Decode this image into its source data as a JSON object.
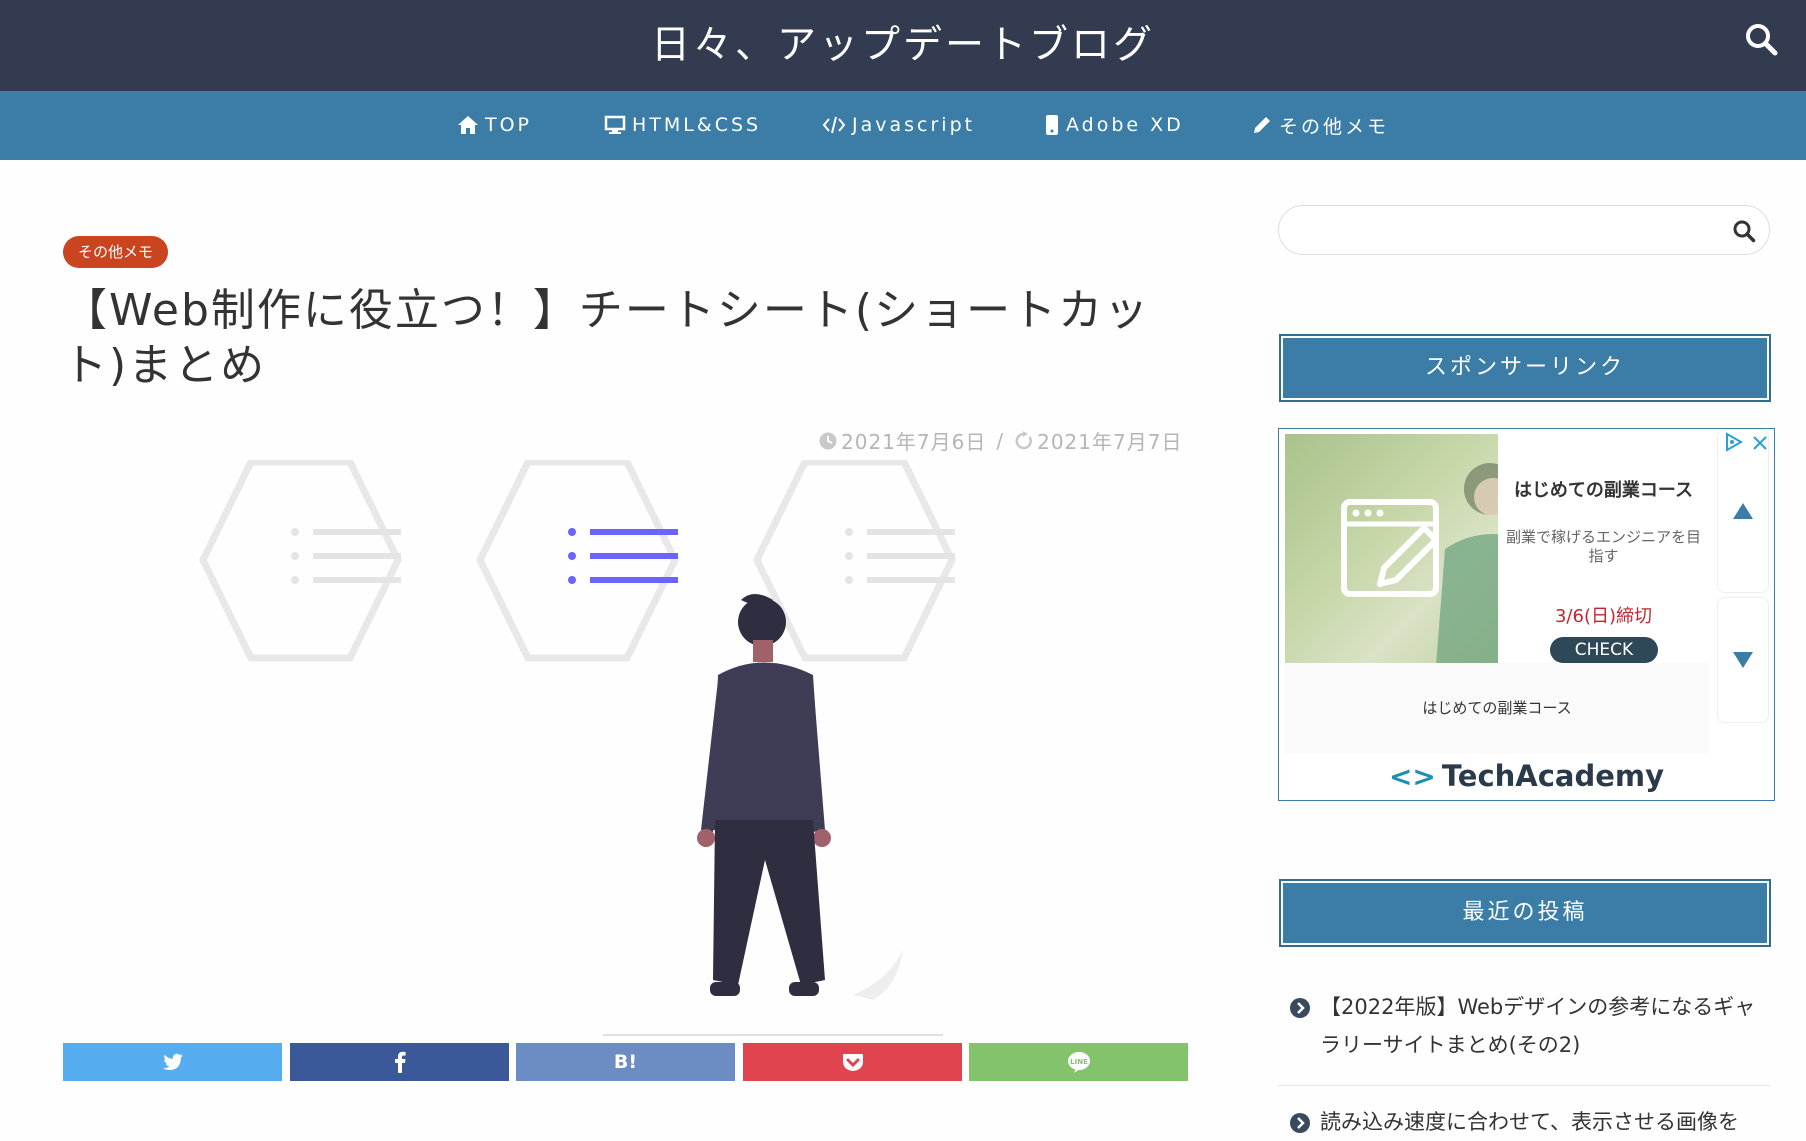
{
  "header": {
    "site_title": "日々、アップデートブログ",
    "search_icon": "search-icon",
    "colors": {
      "header_bg": "#323b4f",
      "nav_bg": "#3b7da6",
      "accent": "#c9441f"
    }
  },
  "nav": {
    "items": [
      {
        "label": "TOP",
        "icon": "home-icon"
      },
      {
        "label": "HTML&CSS",
        "icon": "monitor-icon"
      },
      {
        "label": "Javascript",
        "icon": "code-icon"
      },
      {
        "label": "Adobe XD",
        "icon": "mobile-icon"
      },
      {
        "label": "その他メモ",
        "icon": "pencil-icon"
      }
    ]
  },
  "article": {
    "category": "その他メモ",
    "title": "【Web制作に役立つ！】チートシート(ショートカット)まとめ",
    "published": "2021年7月6日",
    "separator": "/",
    "updated": "2021年7月7日"
  },
  "share": {
    "buttons": [
      {
        "service": "twitter",
        "icon": "twitter-icon",
        "color": "#55acee"
      },
      {
        "service": "facebook",
        "icon": "facebook-icon",
        "color": "#3b5998"
      },
      {
        "service": "hatena",
        "label": "B!",
        "color": "#6b8dc4"
      },
      {
        "service": "pocket",
        "icon": "pocket-icon",
        "color": "#e0444f"
      },
      {
        "service": "line",
        "icon": "line-icon",
        "color": "#83c36b"
      }
    ]
  },
  "sidebar": {
    "search_placeholder": "",
    "sponsor_title": "スポンサーリンク",
    "ad": {
      "headline": "はじめての副業コース",
      "sub": "副業で稼げるエンジニアを目指す",
      "deadline": "3/6(日)締切",
      "cta": "CHECK",
      "caption": "はじめての副業コース",
      "brand": "TechAcademy"
    },
    "recent_title": "最近の投稿",
    "recent_posts": [
      "【2022年版】Webデザインの参考になるギャラリーサイトまとめ(その2)",
      "読み込み速度に合わせて、表示させる画像を"
    ]
  }
}
